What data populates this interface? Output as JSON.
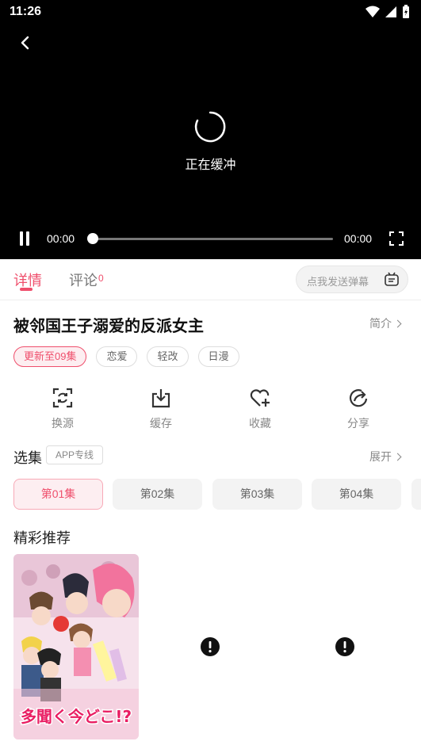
{
  "status_bar": {
    "time": "11:26"
  },
  "player": {
    "buffering_text": "正在缓冲",
    "current_time": "00:00",
    "total_time": "00:00",
    "progress": 0
  },
  "tabs": {
    "detail_label": "详情",
    "comment_label": "评论",
    "comment_count": "0",
    "danmu_placeholder": "点我发送弹幕"
  },
  "show": {
    "title": "被邻国王子溺爱的反派女主",
    "intro_label": "简介",
    "tags": [
      "更新至09集",
      "恋爱",
      "轻改",
      "日漫"
    ]
  },
  "actions": [
    {
      "label": "换源",
      "icon": "swap-source-icon"
    },
    {
      "label": "缓存",
      "icon": "download-icon"
    },
    {
      "label": "收藏",
      "icon": "heart-add-icon"
    },
    {
      "label": "分享",
      "icon": "share-icon"
    }
  ],
  "episodes": {
    "label": "选集",
    "badge": "APP专线",
    "expand_label": "展开",
    "items": [
      "第01集",
      "第02集",
      "第03集",
      "第04集"
    ],
    "selected": "第01集"
  },
  "recommend": {
    "title": "精彩推荐",
    "cover_text": "多聞く今どこ!?"
  },
  "colors": {
    "accent": "#ef4f6c",
    "player_bg": "#000000"
  }
}
